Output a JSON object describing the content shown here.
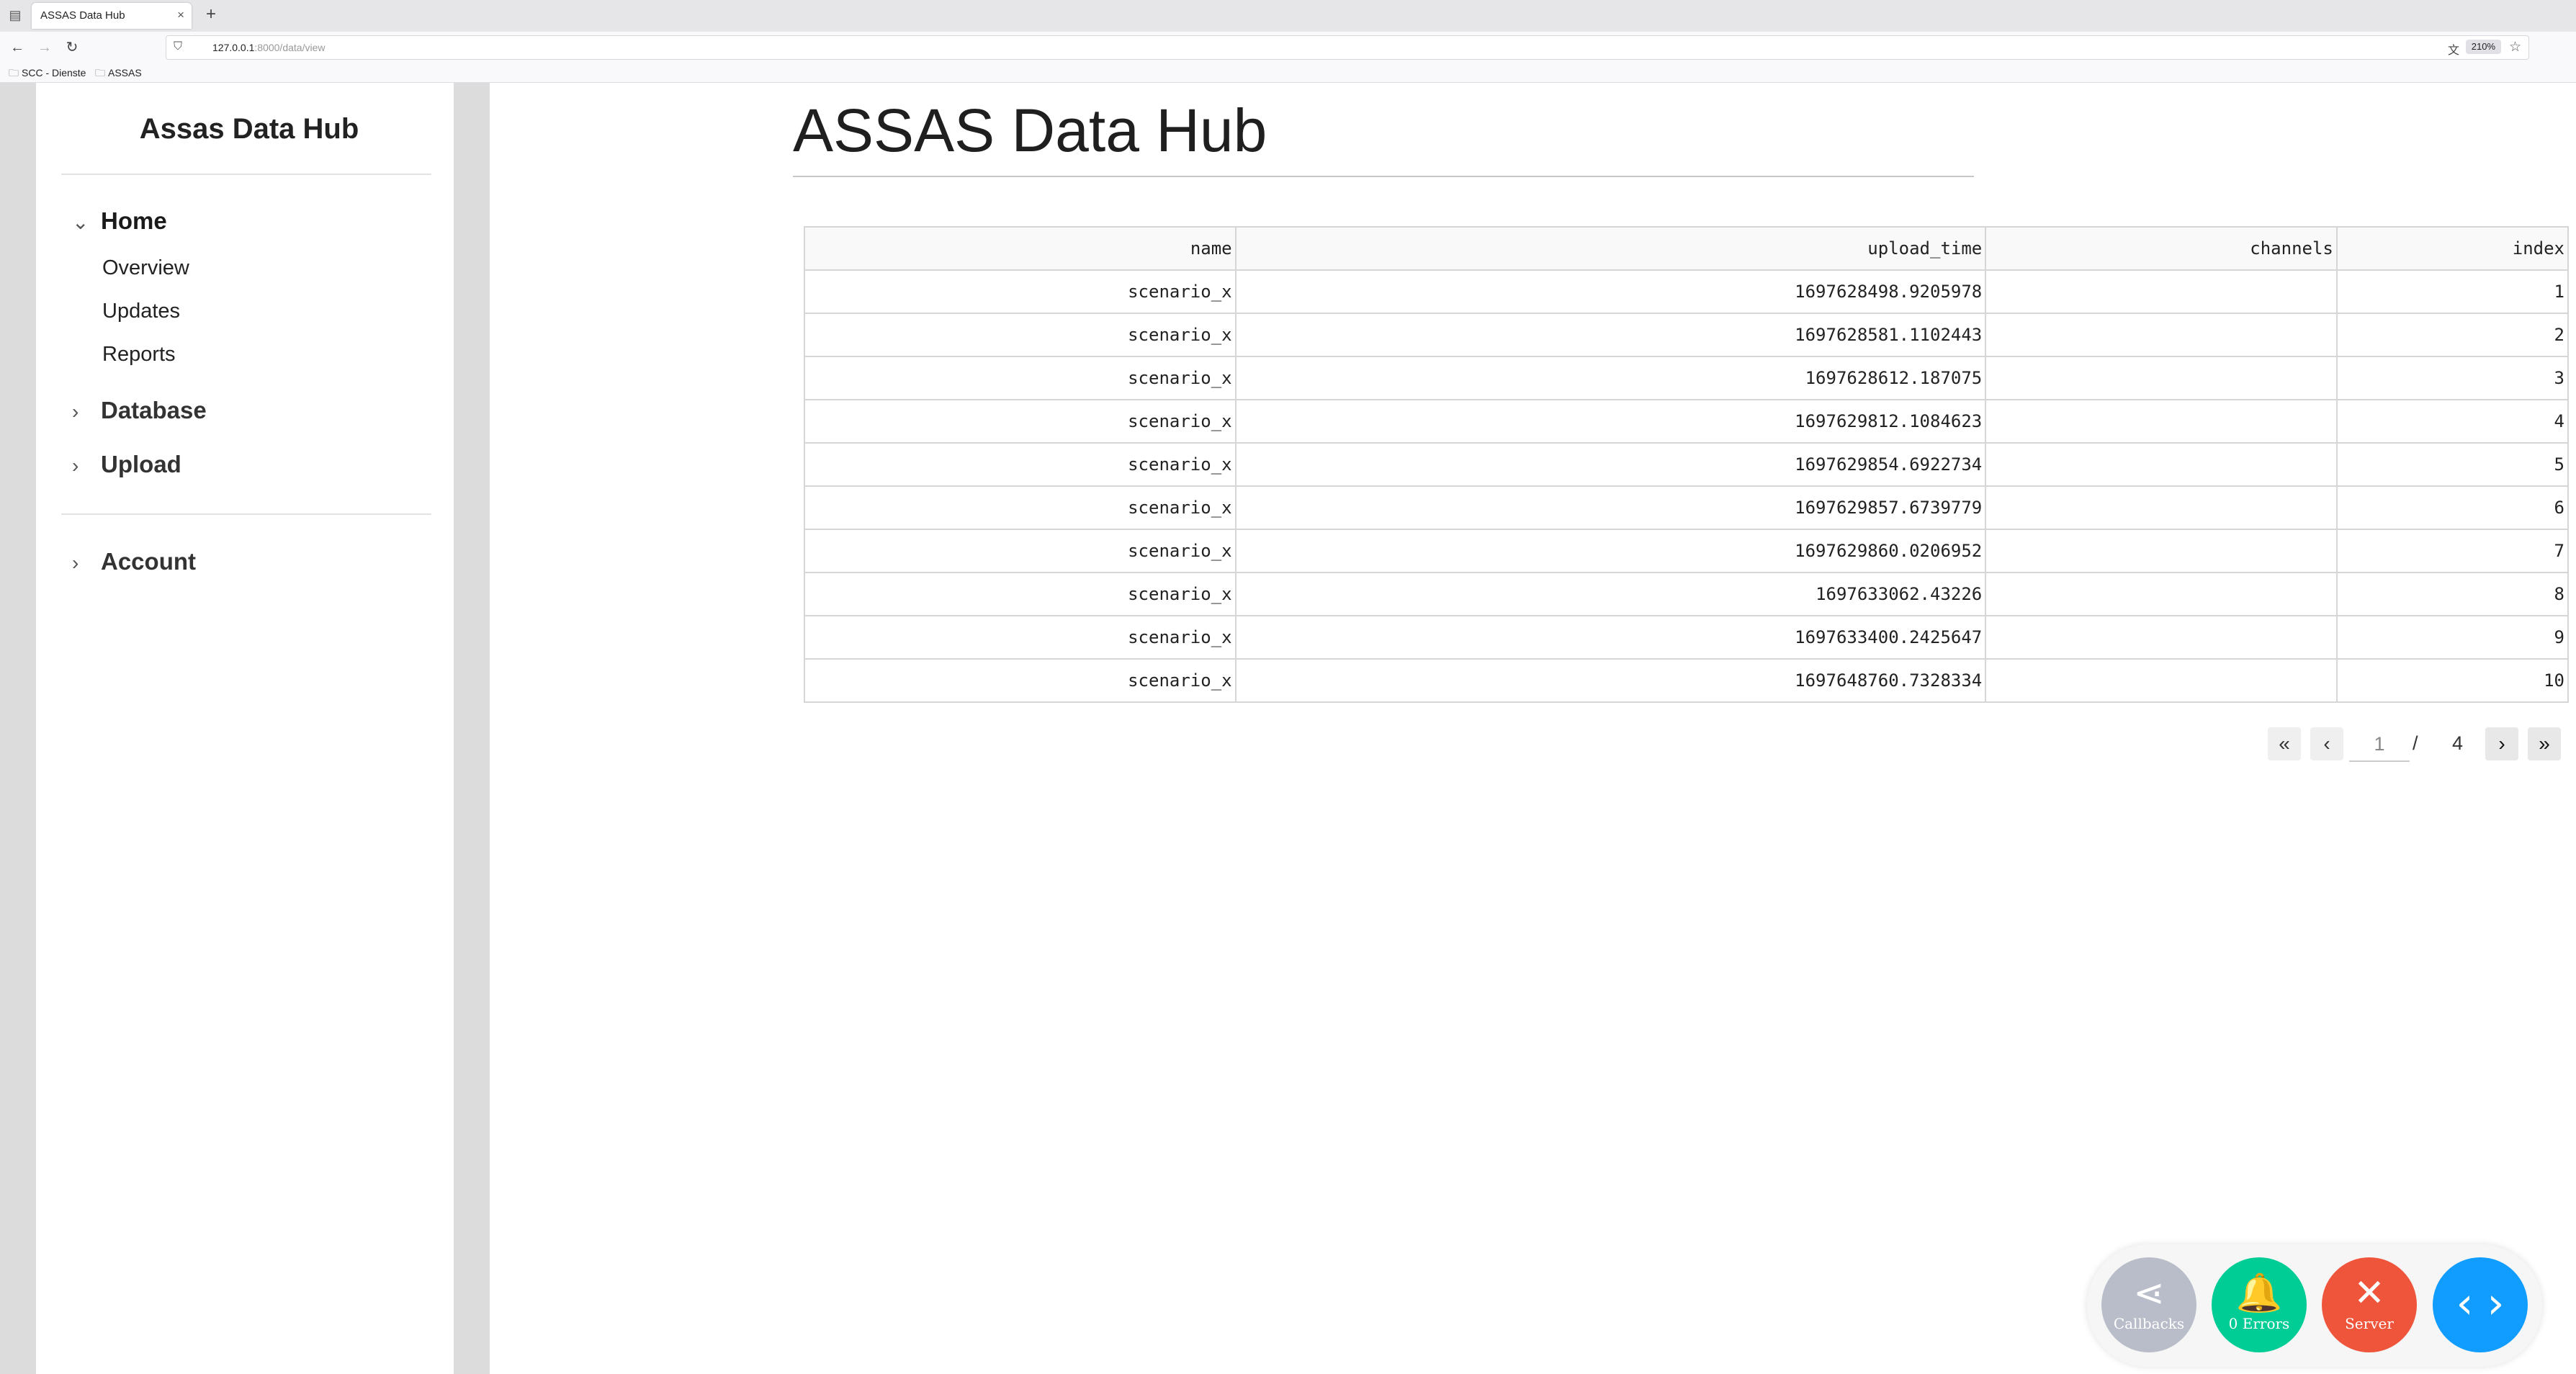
{
  "browser": {
    "tab_title": "ASSAS Data Hub",
    "tab_close": "×",
    "new_tab": "+",
    "url_host": "127.0.0.1",
    "url_rest": ":8000/data/view",
    "zoom": "210%",
    "bookmarks": [
      "SCC - Dienste",
      "ASSAS"
    ]
  },
  "sidebar": {
    "brand": "Assas Data Hub",
    "sections": [
      {
        "label": "Home",
        "open": true,
        "items": [
          "Overview",
          "Updates",
          "Reports"
        ]
      },
      {
        "label": "Database",
        "open": false
      },
      {
        "label": "Upload",
        "open": false
      },
      {
        "label": "Account",
        "open": false
      }
    ]
  },
  "main": {
    "title": "ASSAS Data Hub",
    "table": {
      "columns": [
        "name",
        "upload_time",
        "channels",
        "index"
      ],
      "rows": [
        [
          "scenario_x",
          "1697628498.9205978",
          "",
          "1"
        ],
        [
          "scenario_x",
          "1697628581.1102443",
          "",
          "2"
        ],
        [
          "scenario_x",
          "1697628612.187075",
          "",
          "3"
        ],
        [
          "scenario_x",
          "1697629812.1084623",
          "",
          "4"
        ],
        [
          "scenario_x",
          "1697629854.6922734",
          "",
          "5"
        ],
        [
          "scenario_x",
          "1697629857.6739779",
          "",
          "6"
        ],
        [
          "scenario_x",
          "1697629860.0206952",
          "",
          "7"
        ],
        [
          "scenario_x",
          "1697633062.43226",
          "",
          "8"
        ],
        [
          "scenario_x",
          "1697633400.2425647",
          "",
          "9"
        ],
        [
          "scenario_x",
          "1697648760.7328334",
          "",
          "10"
        ]
      ]
    },
    "pager": {
      "current": "1",
      "separator": "/",
      "total": "4"
    }
  },
  "devtools": {
    "callbacks_label": "Callbacks",
    "errors_label": "0 Errors",
    "server_label": "Server",
    "colors": {
      "callbacks": "#b9bdc9",
      "errors": "#00cc96",
      "server": "#ef553b",
      "toggle": "#119dff"
    }
  }
}
